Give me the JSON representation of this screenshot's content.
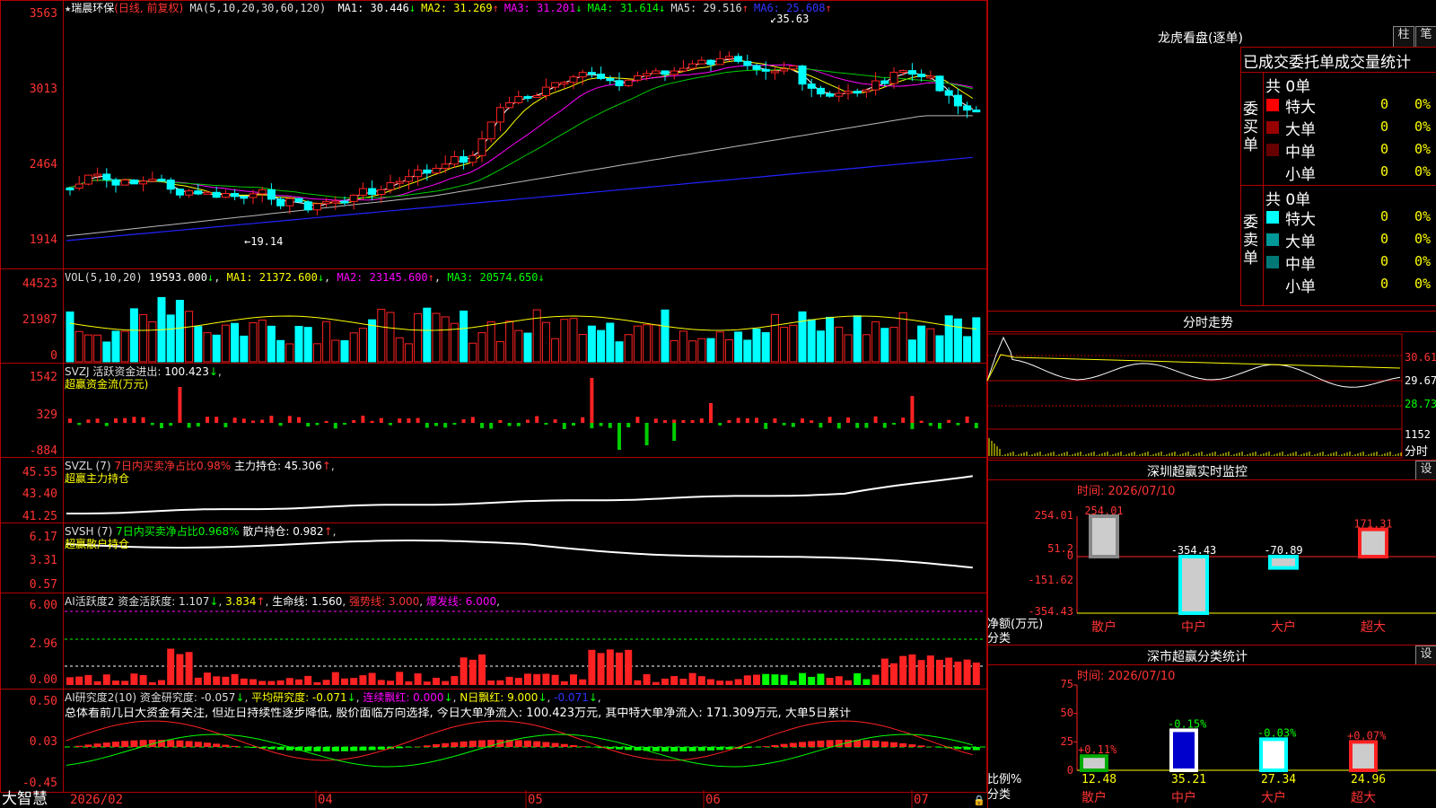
{
  "main_chart": {
    "y_ticks": [
      "3563",
      "3013",
      "2464",
      "1914"
    ],
    "stock": "瑞晨环保",
    "period": "(日线, 前复权)",
    "ma_params": "MA(5,10,20,30,60,120)",
    "ma": [
      {
        "label": "MA1:",
        "value": "30.446",
        "arrow": "↓",
        "color": "#ffffff"
      },
      {
        "label": "MA2:",
        "value": "31.269",
        "arrow": "↑",
        "color": "#ffff00"
      },
      {
        "label": "MA3:",
        "value": "31.201",
        "arrow": "↓",
        "color": "#ff00ff"
      },
      {
        "label": "MA4:",
        "value": "31.614",
        "arrow": "↓",
        "color": "#00ff00"
      },
      {
        "label": "MA5:",
        "value": "29.516",
        "arrow": "↑",
        "color": "#dddddd"
      },
      {
        "label": "MA6:",
        "value": "25.608",
        "arrow": "↑",
        "color": "#3333ff"
      }
    ],
    "high_label": "35.63",
    "low_label": "19.14"
  },
  "vol_panel": {
    "y_ticks": [
      "44523",
      "21987",
      "0"
    ],
    "params": "VOL(5,10,20)",
    "value": "19593.000",
    "ma1": "21372.600",
    "ma2": "23145.600",
    "ma3": "20574.650"
  },
  "svzj_panel": {
    "y_ticks": [
      "1542",
      "329",
      "-884"
    ],
    "label": "SVZJ  活跃资金进出:",
    "value": "100.423",
    "sub": "超赢资金流(万元)"
  },
  "svzl_panel": {
    "y_ticks": [
      "45.55",
      "43.40",
      "41.25"
    ],
    "prefix": "SVZL (7)",
    "ratio": "7日内买卖净占比0.98%",
    "hold": "主力持仓: 45.306",
    "sub": "超赢主力持仓"
  },
  "svsh_panel": {
    "y_ticks": [
      "6.17",
      "3.31",
      "0.57"
    ],
    "prefix": "SVSH (7)",
    "ratio": "7日内买卖净占比0.968%",
    "hold": "散户持仓: 0.982",
    "sub": "超赢散户持仓"
  },
  "ai_active_panel": {
    "y_ticks": [
      "6.00",
      "2.96",
      "0.00"
    ],
    "label": "AI活跃度2 资金活跃度: 1.107",
    "v2": "3.834",
    "life": "生命线: 1.560",
    "strong": "强势线: 3.000",
    "burst": "爆发线: 6.000"
  },
  "ai_research_panel": {
    "y_ticks": [
      "0.50",
      "0.03",
      "-0.45"
    ],
    "label": "AI研究度2(10) 资金研究度: -0.057",
    "avg": "平均研究度: -0.071",
    "red": "连续飘红: 0.000",
    "nred": "N日飘红: 9.000",
    "last": "-0.071",
    "commentary": "总体看前几日大资金有关注, 但近日持续性逐步降低, 股价面临方向选择, 今日大单净流入: 100.423万元, 其中特大单净流入: 171.309万元, 大单5日累计"
  },
  "bottom_axis": {
    "brand": "大智慧",
    "dates": [
      "2026/02",
      "04",
      "05",
      "06",
      "07"
    ]
  },
  "dragon_tiger": {
    "title": "龙虎看盘(逐单)",
    "btn_zhu": "柱",
    "btn_bi": "笔",
    "subtitle": "已成交委托单成交量统计",
    "buy_side_label": "委买单",
    "sell_side_label": "委卖单",
    "buy_total": "共 0单",
    "sell_total": "共 0单",
    "buy_rows": [
      {
        "name": "特大",
        "count": "0",
        "pct": "0%",
        "color": "#ff0000"
      },
      {
        "name": "大单",
        "count": "0",
        "pct": "0%",
        "color": "#990000"
      },
      {
        "name": "中单",
        "count": "0",
        "pct": "0%",
        "color": "#660000"
      },
      {
        "name": "小单",
        "count": "0",
        "pct": "0%",
        "color": "#000000"
      }
    ],
    "sell_rows": [
      {
        "name": "特大",
        "count": "0",
        "pct": "0%",
        "color": "#00ffff"
      },
      {
        "name": "大单",
        "count": "0",
        "pct": "0%",
        "color": "#009999"
      },
      {
        "name": "中单",
        "count": "0",
        "pct": "0%",
        "color": "#007777"
      },
      {
        "name": "小单",
        "count": "0",
        "pct": "0%",
        "color": "#000000"
      }
    ]
  },
  "intraday": {
    "title": "分时走势",
    "prices": [
      "30.61",
      "29.67",
      "28.73"
    ],
    "vol_max": "1152",
    "vol_unit": "分时"
  },
  "sz_monitor": {
    "title": "深圳超赢实时监控",
    "btn": "设",
    "time": "时间: 2026/07/10",
    "y_ticks": [
      "254.01",
      "51.2",
      "0",
      "-151.62",
      "-354.43"
    ],
    "axis_label": "净额(万元)",
    "axis_sub": "分类"
  },
  "sz_classify": {
    "title": "深市超赢分类统计",
    "btn": "设",
    "time": "时间: 2026/07/10",
    "y_ticks": [
      "75",
      "50",
      "25",
      "0"
    ],
    "axis_label": "比例%",
    "axis_sub": "分类"
  },
  "chart_data": [
    {
      "type": "bar",
      "title": "深圳超赢实时监控",
      "ylabel": "净额(万元)",
      "categories": [
        "散户",
        "中户",
        "大户",
        "超大"
      ],
      "values": [
        254.01,
        -354.43,
        -70.89,
        171.31
      ],
      "value_labels": [
        "254.01",
        "-354.43",
        "-70.89",
        "171.31"
      ],
      "ylim": [
        -354.43,
        254.01
      ]
    },
    {
      "type": "bar",
      "title": "深市超赢分类统计",
      "ylabel": "比例%",
      "categories": [
        "散户",
        "中户",
        "大户",
        "超大"
      ],
      "values": [
        12.48,
        35.21,
        27.34,
        24.96
      ],
      "value_labels": [
        "12.48",
        "35.21",
        "27.34",
        "24.96"
      ],
      "change_labels": [
        "+0.11%",
        "-0.15%",
        "-0.03%",
        "+0.07%"
      ],
      "ylim": [
        0,
        75
      ]
    }
  ]
}
